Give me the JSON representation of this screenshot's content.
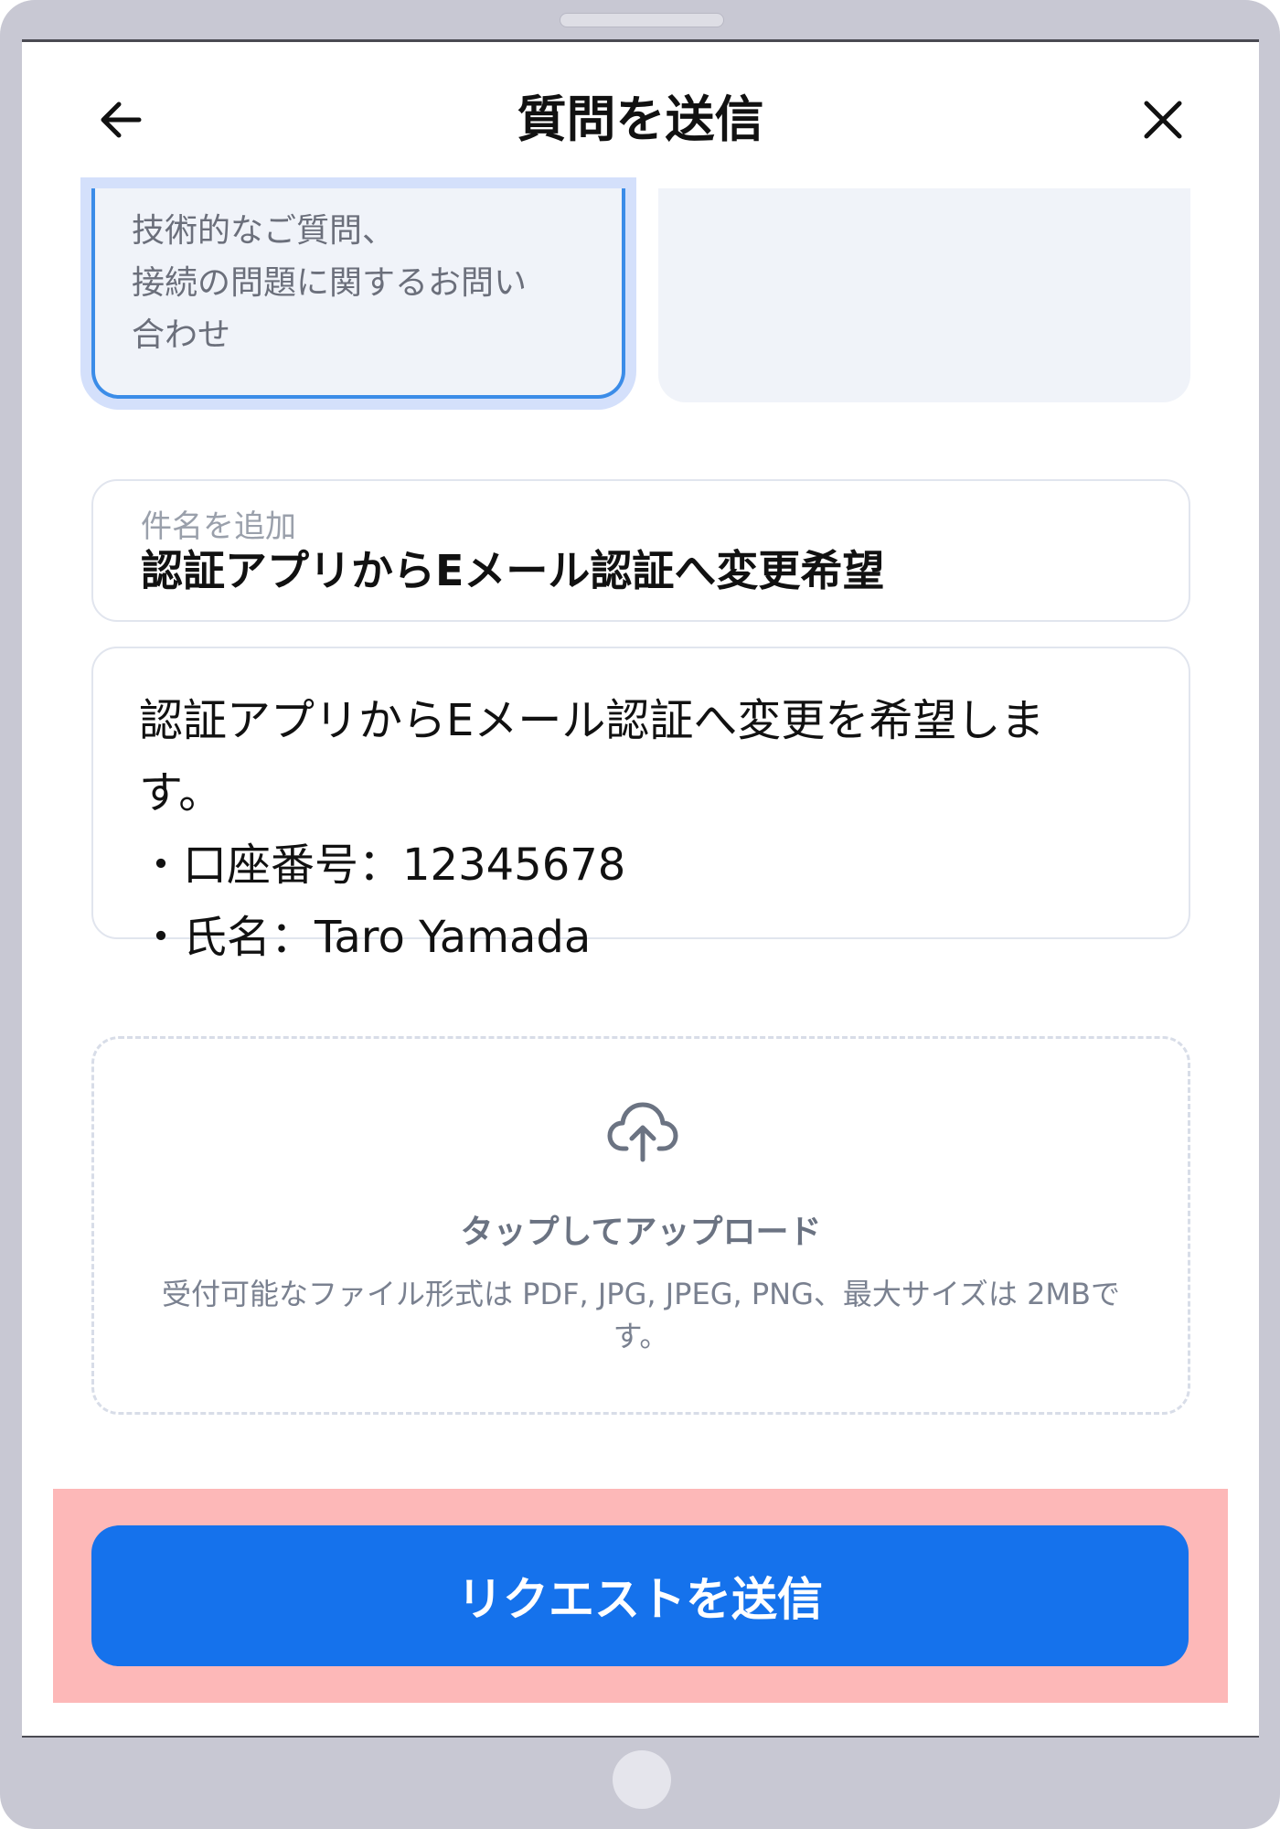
{
  "header": {
    "title": "質問を送信",
    "back_icon": "arrow-left-icon",
    "close_icon": "close-icon"
  },
  "category_cards": [
    {
      "description": "技術的なご質問、\n接続の問題に関するお問い\n合わせ",
      "selected": true
    },
    {
      "description": "",
      "selected": false
    }
  ],
  "subject": {
    "label": "件名を追加",
    "value": "認証アプリからEメール認証へ変更希望"
  },
  "message": {
    "lines": [
      "認証アプリからEメール認証へ変更を希望しま",
      "す。",
      "・口座番号：12345678",
      "・氏名：Taro Yamada"
    ]
  },
  "upload": {
    "icon": "cloud-upload-icon",
    "label": "タップしてアップロード",
    "note": "受付可能なファイル形式は PDF, JPG, JPEG, PNG、最大サイズは 2MBです。"
  },
  "submit": {
    "label": "リクエストを送信"
  },
  "colors": {
    "primary": "#1572ec",
    "selected_border": "#3b8ce8",
    "highlight": "#fdb8b8",
    "device_frame": "#c8c8d3"
  }
}
